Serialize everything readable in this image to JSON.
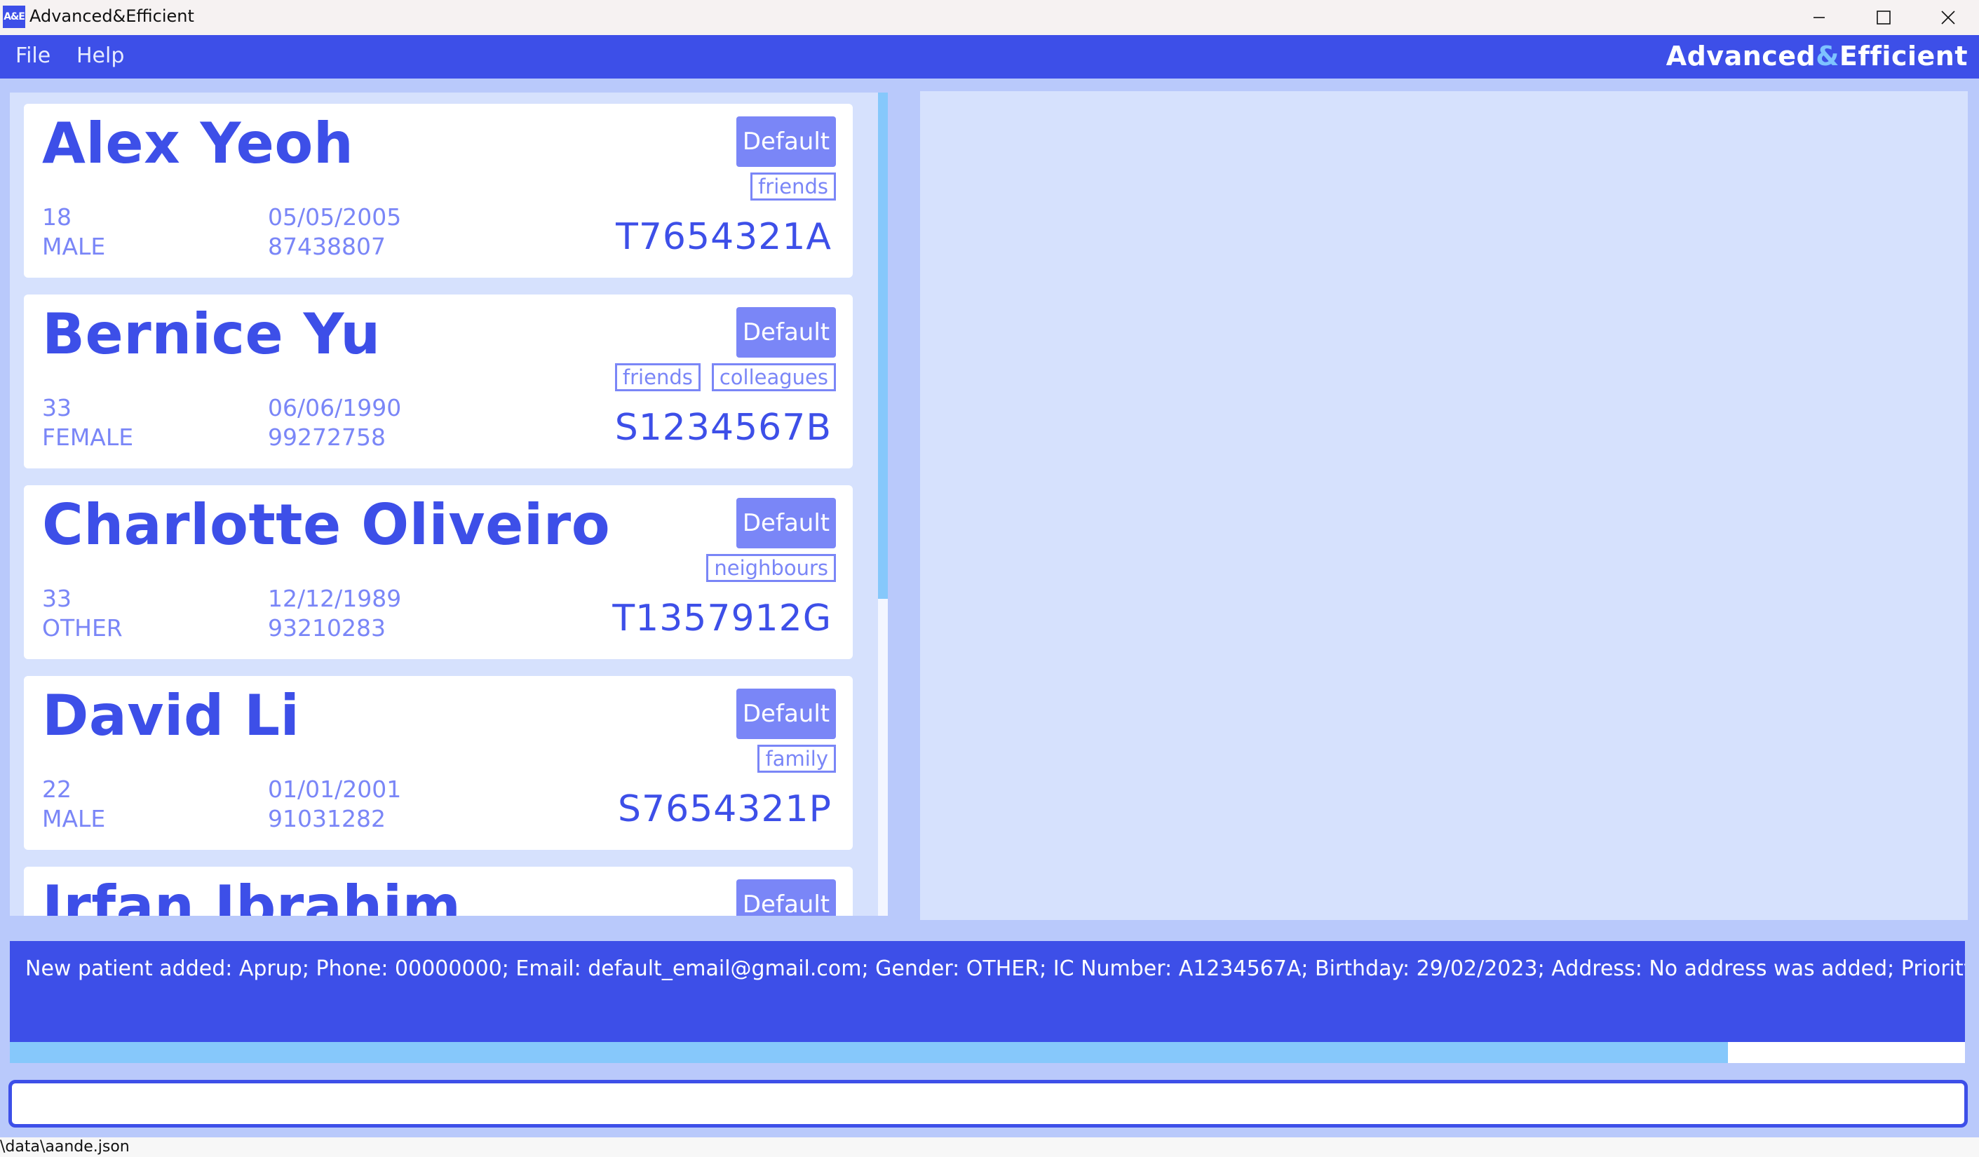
{
  "window": {
    "icon_text": "A&E",
    "title": "Advanced&Efficient"
  },
  "menubar": {
    "items": [
      "File",
      "Help"
    ],
    "brand_prefix": "Advanced",
    "brand_amp": "&",
    "brand_suffix": "Efficient"
  },
  "patients": [
    {
      "name": "Alex Yeoh",
      "priority": "Default",
      "tags": [
        "friends"
      ],
      "age": "18",
      "gender": "MALE",
      "birthday": "05/05/2005",
      "phone": "87438807",
      "ic": "T7654321A"
    },
    {
      "name": "Bernice Yu",
      "priority": "Default",
      "tags": [
        "friends",
        "colleagues"
      ],
      "age": "33",
      "gender": "FEMALE",
      "birthday": "06/06/1990",
      "phone": "99272758",
      "ic": "S1234567B"
    },
    {
      "name": "Charlotte Oliveiro",
      "priority": "Default",
      "tags": [
        "neighbours"
      ],
      "age": "33",
      "gender": "OTHER",
      "birthday": "12/12/1989",
      "phone": "93210283",
      "ic": "T1357912G"
    },
    {
      "name": "David Li",
      "priority": "Default",
      "tags": [
        "family"
      ],
      "age": "22",
      "gender": "MALE",
      "birthday": "01/01/2001",
      "phone": "91031282",
      "ic": "S7654321P"
    },
    {
      "name": "Irfan Ibrahim",
      "priority": "Default",
      "tags": [],
      "age": "",
      "gender": "",
      "birthday": "",
      "phone": "",
      "ic": ""
    }
  ],
  "result": {
    "text": "New patient added: Aprup; Phone: 00000000; Email: default_email@gmail.com; Gender: OTHER; IC Number: A1234567A; Birthday: 29/02/2023; Address: No address was added; Priority: NIL; Default"
  },
  "command": {
    "value": "",
    "placeholder": ""
  },
  "status": {
    "path": "\\data\\aande.json"
  },
  "colors": {
    "primary": "#3d4fe8",
    "accent_light": "#7a86f7",
    "panel": "#d6e1fd",
    "background": "#b9c9fb",
    "scroll": "#86c8fb"
  }
}
